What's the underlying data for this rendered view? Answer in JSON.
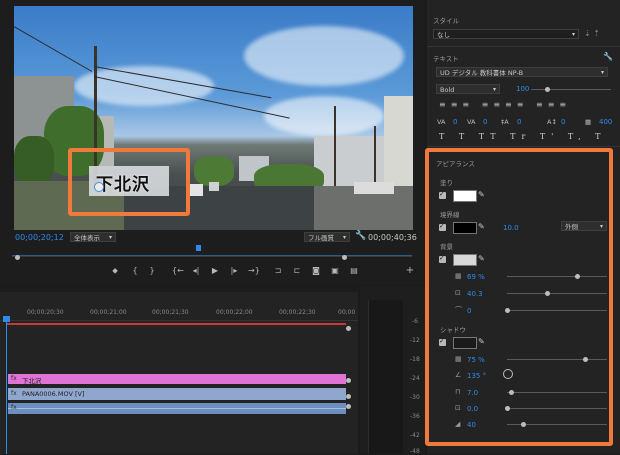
{
  "monitor": {
    "timecode_current": "00;00;20;12",
    "timecode_total": "00;00;40;36",
    "zoom": "全体表示",
    "quality": "フル画質",
    "title_text": "下北沢"
  },
  "timeline": {
    "ruler": [
      "00;00;20;30",
      "00;00;21;00",
      "00;00;21;30",
      "00;00;22;00",
      "00;00;22;30",
      "00;00"
    ],
    "clips": {
      "graphic": "下北沢",
      "video": "PANA0006.MOV [V]"
    }
  },
  "meter": {
    "ticks": [
      "-6",
      "-12",
      "-18",
      "-24",
      "-30",
      "-36",
      "-42",
      "-48"
    ]
  },
  "panel": {
    "style_label": "スタイル",
    "style_value": "なし",
    "text_label": "テキスト",
    "font_name": "UD デジタル 教科書体 NP-B",
    "font_weight": "Bold",
    "font_size": "100",
    "tracking_vals": [
      "0",
      "0",
      "0",
      "0",
      "400"
    ],
    "appearance_label": "アピアランス",
    "fill_label": "塗り",
    "stroke_label": "境界線",
    "stroke_width": "10.0",
    "stroke_type": "外側",
    "background_label": "背景",
    "bg_opacity": "69 %",
    "bg_size": "40.3",
    "bg_corner": "0",
    "shadow_label": "シャドウ",
    "shadow_opacity": "75 %",
    "shadow_angle": "135 °",
    "shadow_distance": "7.0",
    "shadow_size": "0.0",
    "shadow_blur": "40",
    "colors": {
      "fill": "#ffffff",
      "stroke": "#000000",
      "background": "#d8d8d8",
      "shadow": "#1a1a1a",
      "accent_blue": "#2d8ceb",
      "highlight_orange": "#f0793b"
    }
  }
}
